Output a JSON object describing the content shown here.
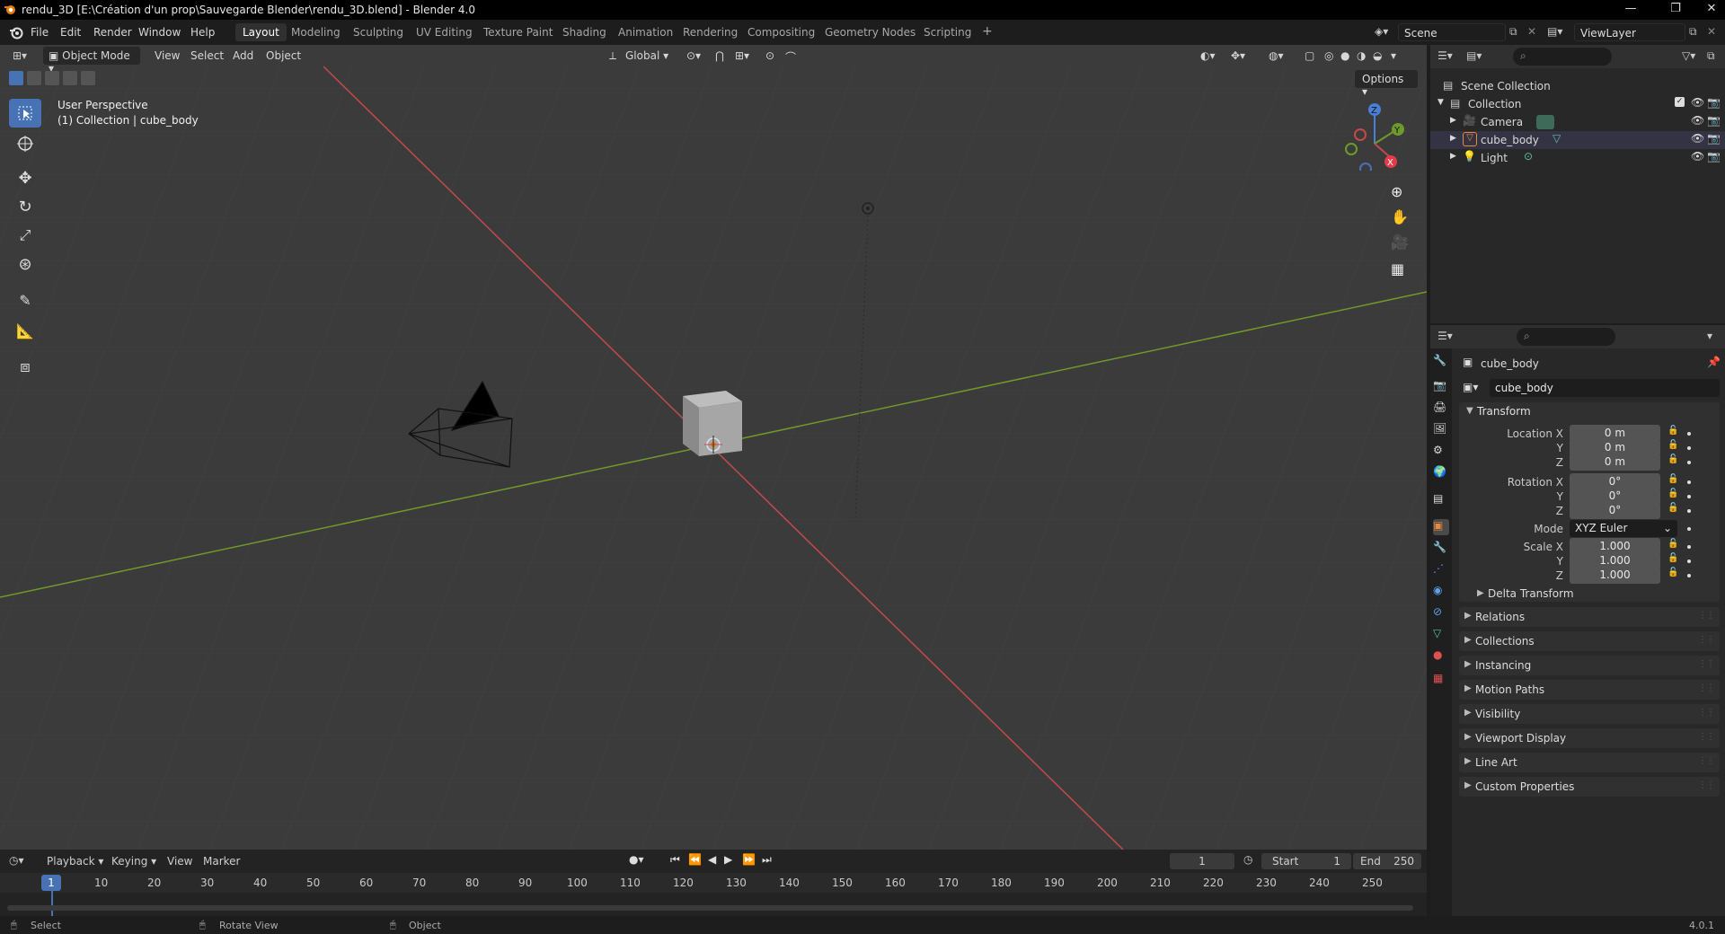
{
  "window": {
    "title": "rendu_3D [E:\\Création d'un prop\\Sauvegarde Blender\\rendu_3D.blend] - Blender 4.0"
  },
  "menu": [
    "File",
    "Edit",
    "Render",
    "Window",
    "Help"
  ],
  "workspaces": [
    "Layout",
    "Modeling",
    "Sculpting",
    "UV Editing",
    "Texture Paint",
    "Shading",
    "Animation",
    "Rendering",
    "Compositing",
    "Geometry Nodes",
    "Scripting"
  ],
  "active_workspace": "Layout",
  "scene": {
    "label": "Scene"
  },
  "view_layer": {
    "label": "ViewLayer"
  },
  "viewport_header": {
    "mode": "Object Mode",
    "menus": [
      "View",
      "Select",
      "Add",
      "Object"
    ],
    "orientation": "Global",
    "options": "Options"
  },
  "viewport": {
    "info_line1": "User Perspective",
    "info_line2": "(1) Collection | cube_body",
    "gizmo_axes": {
      "x": "X",
      "y": "Y",
      "z": "Z"
    }
  },
  "outliner": {
    "root": "Scene Collection",
    "collection": "Collection",
    "items": [
      "Camera",
      "cube_body",
      "Light"
    ]
  },
  "properties": {
    "object_name": "cube_body",
    "datablock_name": "cube_body",
    "transform_title": "Transform",
    "location_label": "Location X",
    "rotation_label": "Rotation X",
    "scale_label": "Scale X",
    "y_label": "Y",
    "z_label": "Z",
    "location": [
      "0 m",
      "0 m",
      "0 m"
    ],
    "rotation": [
      "0°",
      "0°",
      "0°"
    ],
    "mode_label": "Mode",
    "mode_value": "XYZ Euler",
    "scale": [
      "1.000",
      "1.000",
      "1.000"
    ],
    "delta_transform": "Delta Transform",
    "panels": [
      "Relations",
      "Collections",
      "Instancing",
      "Motion Paths",
      "Visibility",
      "Viewport Display",
      "Line Art",
      "Custom Properties"
    ]
  },
  "timeline": {
    "menus": [
      "Playback",
      "Keying",
      "View",
      "Marker"
    ],
    "current_frame": "1",
    "start_label": "Start",
    "start_value": "1",
    "end_label": "End",
    "end_value": "250",
    "ticks": [
      "1",
      "10",
      "20",
      "30",
      "40",
      "50",
      "60",
      "70",
      "80",
      "90",
      "100",
      "110",
      "120",
      "130",
      "140",
      "150",
      "160",
      "170",
      "180",
      "190",
      "200",
      "210",
      "220",
      "230",
      "240",
      "250"
    ]
  },
  "statusbar": {
    "select": "Select",
    "rotate": "Rotate View",
    "object": "Object",
    "version": "4.0.1"
  },
  "colors": {
    "accent": "#4772b3",
    "x_axis": "#c24a4a",
    "y_axis": "#6f9a2a",
    "z_axis": "#4a7fd6"
  }
}
